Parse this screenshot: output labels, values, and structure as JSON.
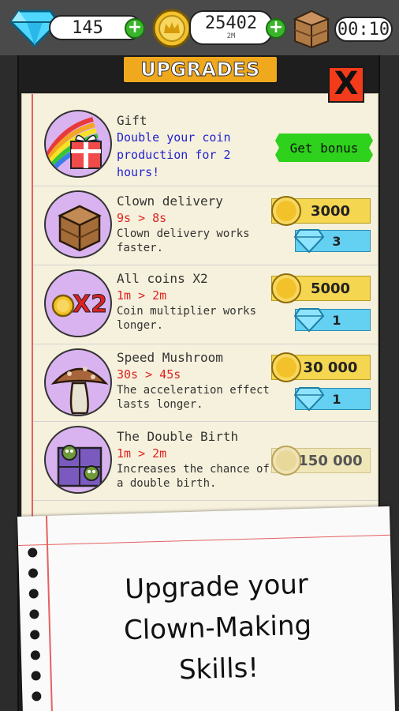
{
  "topbar": {
    "gems": "145",
    "coins": "25402",
    "coins_sub": "2M",
    "timer": "00:10",
    "plus_label": "+"
  },
  "panel": {
    "title": "UPGRADES",
    "close_label": "X"
  },
  "gift": {
    "name": "Gift",
    "description": "Double your coin production for 2 hours!",
    "button_label": "Get bonus"
  },
  "upgrades": [
    {
      "name": "Clown delivery",
      "change": "9s > 8s",
      "description": "Clown delivery works faster.",
      "coin_cost": "3000",
      "gem_cost": "3",
      "icon": "crate-icon"
    },
    {
      "name": "All coins X2",
      "change": "1m > 2m",
      "description": "Coin multiplier works longer.",
      "coin_cost": "5000",
      "gem_cost": "1",
      "icon": "coin-x2-icon",
      "icon_text": "X2"
    },
    {
      "name": "Speed Mushroom",
      "change": "30s > 45s",
      "description": "The acceleration effect lasts longer.",
      "coin_cost": "30 000",
      "gem_cost": "1",
      "icon": "mushroom-icon"
    },
    {
      "name": "The Double Birth",
      "change": "1m > 2m",
      "description": "Increases the chance of a double birth.",
      "coin_cost": "150 000",
      "icon": "zombie-box-icon"
    }
  ],
  "note": {
    "line1": "Upgrade your",
    "line2": "Clown-Making",
    "line3": "Skills!"
  },
  "colors": {
    "accent_orange": "#f0a81c",
    "close_red": "#f23b1b",
    "bonus_green": "#2ed11c",
    "coin_yellow": "#f5d650",
    "gem_blue": "#64d0f2",
    "icon_purple": "#d9b3f0"
  }
}
